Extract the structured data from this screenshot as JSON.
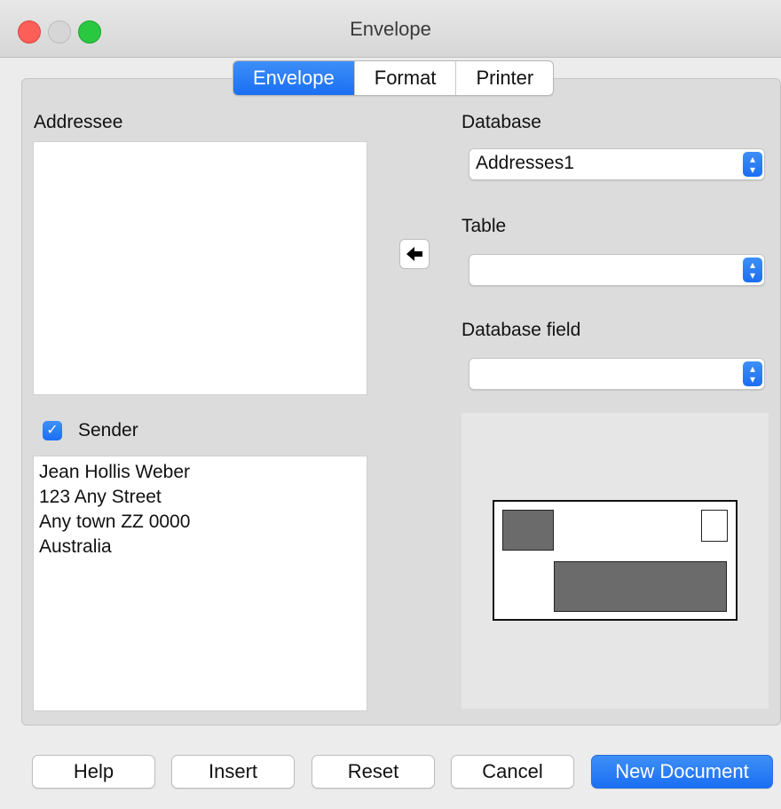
{
  "window": {
    "title": "Envelope"
  },
  "tabs": [
    {
      "label": "Envelope",
      "active": true
    },
    {
      "label": "Format",
      "active": false
    },
    {
      "label": "Printer",
      "active": false
    }
  ],
  "addressee": {
    "label": "Addressee",
    "value": ""
  },
  "sender": {
    "label": "Sender",
    "checked": true,
    "lines": [
      "Jean Hollis Weber",
      "123 Any Street",
      "Any town ZZ 0000",
      "Australia"
    ]
  },
  "database": {
    "label": "Database",
    "value": "Addresses1"
  },
  "table": {
    "label": "Table",
    "value": ""
  },
  "database_field": {
    "label": "Database field",
    "value": ""
  },
  "buttons": {
    "help": "Help",
    "insert": "Insert",
    "reset": "Reset",
    "cancel": "Cancel",
    "new_document": "New Document"
  },
  "colors": {
    "accent": "#1a6ff3",
    "close": "#fc5f57",
    "maximize": "#28c840"
  },
  "icons": {
    "insert_field": "arrow-left-icon",
    "checkbox": "checkmark-icon",
    "stepper": "chevron-updown-icon"
  }
}
